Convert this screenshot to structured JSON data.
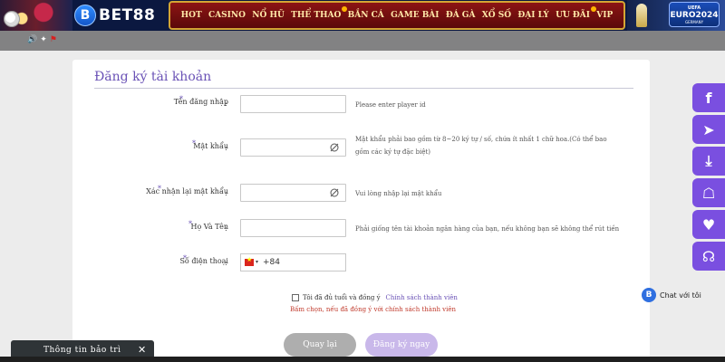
{
  "header": {
    "logo_letter": "B",
    "logo_text": "BET88",
    "nav": [
      {
        "label": "HOT"
      },
      {
        "label": "CASINO"
      },
      {
        "label": "NỔ HŨ"
      },
      {
        "label": "THỂ THAO"
      },
      {
        "label": "BẮN CÁ"
      },
      {
        "label": "GAME BÀI"
      },
      {
        "label": "ĐÁ GÀ"
      },
      {
        "label": "XỔ SỐ"
      },
      {
        "label": "ĐẠI LÝ"
      },
      {
        "label": "ƯU ĐÃI"
      },
      {
        "label": "VIP"
      }
    ],
    "euro_badge": {
      "line1": "UEFA",
      "line2": "EURO2024",
      "line3": "GERMANY"
    }
  },
  "form": {
    "title": "Đăng ký tài khoản",
    "required_mark": "*",
    "colon": ":",
    "fields": [
      {
        "label": "Tên đăng nhập",
        "value": "",
        "hint": "Please enter player id"
      },
      {
        "label": "Mật khẩu",
        "value": "",
        "hint": "Mật khẩu phải bao gồm từ 8~20 ký tự / số, chứa ít nhất 1 chữ hoa.(Có thể bao gồm các ký tự đặc biệt)"
      },
      {
        "label": "Xác nhận lại mật khẩu",
        "value": "",
        "hint": "Vui lòng nhập lại mật khẩu"
      },
      {
        "label": "Họ Và Tên",
        "value": "",
        "hint": "Phải giống tên tài khoản ngân hàng của bạn, nếu không bạn sẽ không thể rút tiền"
      },
      {
        "label": "Số điện thoại",
        "value": "",
        "country_code": "+84"
      }
    ],
    "agree_text": "Tôi đã đủ tuổi và đồng ý",
    "agree_link": "Chính sách thành viên",
    "agree_warning": "Bấm chọn, nếu đã đồng ý với chính sách thành viên",
    "back_button": "Quay lại",
    "register_button": "Đăng ký ngay"
  },
  "rail": [
    {
      "icon": "facebook-icon",
      "glyph": "f"
    },
    {
      "icon": "telegram-icon",
      "glyph": "➤"
    },
    {
      "icon": "download-icon",
      "glyph": "⤓"
    },
    {
      "icon": "agent-icon",
      "glyph": "☖"
    },
    {
      "icon": "charity-icon",
      "glyph": "♥"
    },
    {
      "icon": "support-icon",
      "glyph": "☊"
    }
  ],
  "chat": {
    "icon_letter": "B",
    "label": "Chat với tôi"
  },
  "maintenance": {
    "title": "Thông tin bảo trì",
    "close": "✕"
  },
  "colors": {
    "accent": "#7a4fe0",
    "title": "#6a52b6",
    "nav_bg": "#8c1414",
    "nav_border": "#d4a534"
  }
}
